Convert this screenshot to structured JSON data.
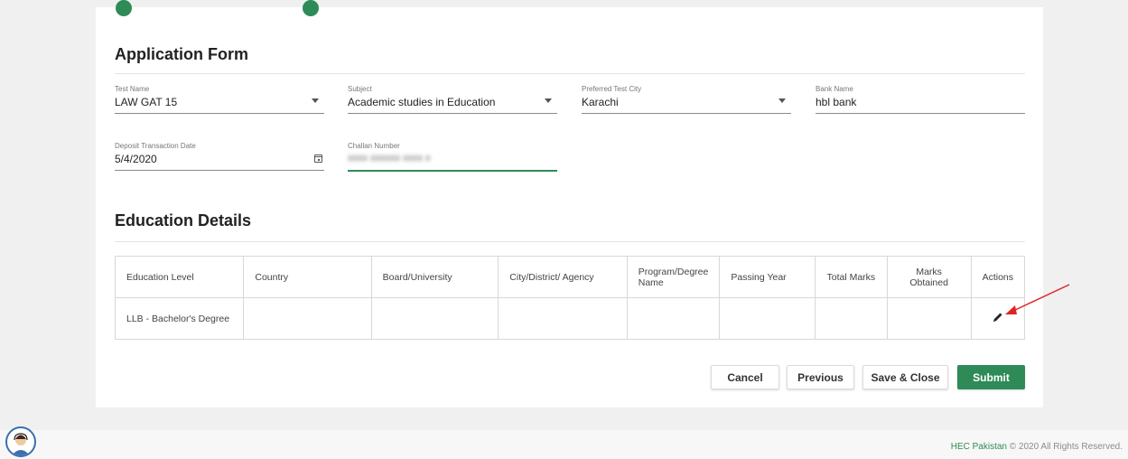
{
  "form": {
    "title": "Application Form",
    "fields": {
      "test_name": {
        "label": "Test Name",
        "value": "LAW GAT 15"
      },
      "subject": {
        "label": "Subject",
        "value": "Academic studies in Education"
      },
      "preferred_city": {
        "label": "Preferred Test City",
        "value": "Karachi"
      },
      "bank_name": {
        "label": "Bank Name",
        "value": "hbl bank"
      },
      "deposit_date": {
        "label": "Deposit Transaction Date",
        "value": "5/4/2020"
      },
      "challan_number": {
        "label": "Challan Number",
        "value": "xxxx xxxxxx xxxx x"
      }
    }
  },
  "education": {
    "title": "Education Details",
    "columns": [
      "Education Level",
      "Country",
      "Board/University",
      "City/District/ Agency",
      "Program/Degree Name",
      "Passing Year",
      "Total Marks",
      "Marks Obtained",
      "Actions"
    ],
    "rows": [
      [
        "LLB - Bachelor's Degree",
        "",
        "",
        "",
        "",
        "",
        "",
        "",
        ""
      ]
    ]
  },
  "buttons": {
    "cancel": "Cancel",
    "previous": "Previous",
    "save_close": "Save & Close",
    "submit": "Submit"
  },
  "footer": {
    "brand": "HEC Pakistan",
    "copyright": " © 2020 All Rights Reserved."
  },
  "icons": {
    "edit": "pencil-icon",
    "calendar": "calendar-icon",
    "dropdown": "chevron-down-icon",
    "support": "support-agent-icon"
  },
  "colors": {
    "accent": "#2e8b57",
    "annotation_arrow": "#e02424"
  }
}
